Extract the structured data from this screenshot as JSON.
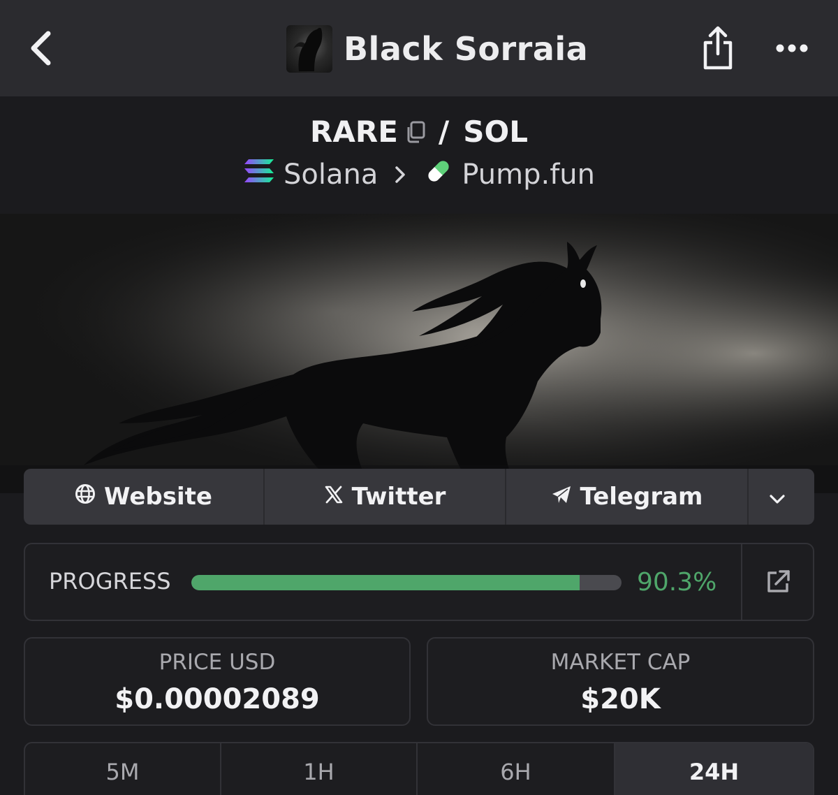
{
  "header": {
    "title": "Black Sorraia",
    "back_icon": "chevron-left-icon",
    "share_icon": "share-icon",
    "more_icon": "more-horizontal-icon"
  },
  "pair": {
    "base": "RARE",
    "separator": "/",
    "quote": "SOL",
    "copy_icon": "copy-icon"
  },
  "chain": {
    "network": "Solana",
    "dex": "Pump.fun",
    "network_icon": "solana-logo-icon",
    "dex_icon": "pill-icon"
  },
  "links": {
    "website": "Website",
    "twitter": "Twitter",
    "telegram": "Telegram"
  },
  "progress": {
    "label": "PROGRESS",
    "value_text": "90.3%",
    "value": 0.903
  },
  "stats": {
    "price_label": "PRICE USD",
    "price_value": "$0.00002089",
    "mcap_label": "MARKET CAP",
    "mcap_value": "$20K"
  },
  "tabs": [
    {
      "label": "5M",
      "sub": "-"
    },
    {
      "label": "1H",
      "sub": "-"
    },
    {
      "label": "6H",
      "sub": ""
    },
    {
      "label": "24H",
      "sub": ""
    }
  ],
  "colors": {
    "accent_green": "#4fa66a",
    "background": "#1b1b1e",
    "header": "#2b2b2f"
  }
}
